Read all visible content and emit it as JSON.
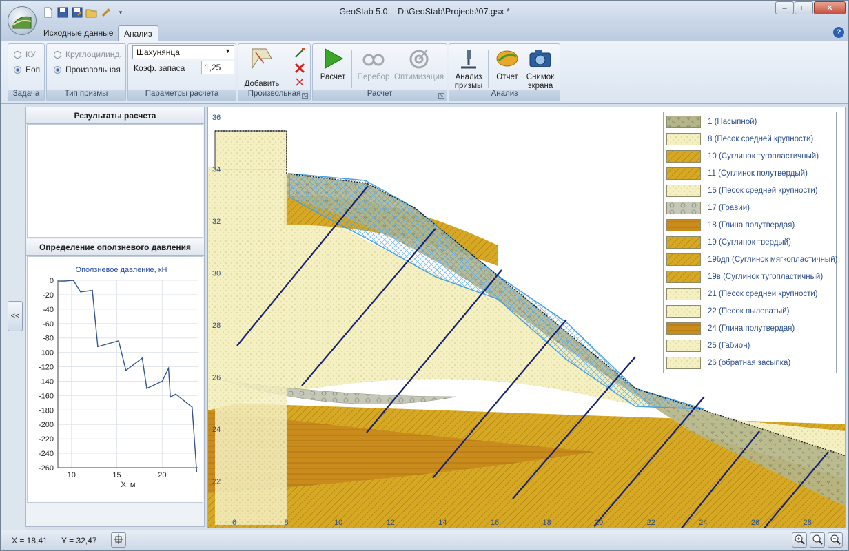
{
  "window": {
    "title": "GeoStab 5.0: - D:\\GeoStab\\Projects\\07.gsx *",
    "controls": {
      "minimize": "–",
      "maximize": "□",
      "close": "✕"
    }
  },
  "quick_access": [
    "new-icon",
    "save-icon",
    "save-as-icon",
    "open-icon",
    "tools-icon"
  ],
  "tabs": [
    {
      "label": "Исходные данные",
      "active": false
    },
    {
      "label": "Анализ",
      "active": true
    }
  ],
  "help_label": "?",
  "ribbon": {
    "task": {
      "caption": "Задача",
      "options": [
        {
          "label": "КУ",
          "selected": false
        },
        {
          "label": "Еоп",
          "selected": true
        }
      ]
    },
    "prism_type": {
      "caption": "Тип призмы",
      "options": [
        {
          "label": "Круглоцилинд.",
          "selected": false
        },
        {
          "label": "Произвольная",
          "selected": true
        }
      ]
    },
    "params": {
      "caption": "Параметры расчета",
      "method": "Шахунянца",
      "factor_label": "Коэф. запаса",
      "factor_value": "1,25"
    },
    "arbitrary": {
      "caption": "Произвольная",
      "add_label": "Добавить"
    },
    "calc": {
      "caption": "Расчет",
      "run_label": "Расчет",
      "search_label": "Перебор",
      "optimize_label": "Оптимизация"
    },
    "analysis": {
      "caption": "Анализ",
      "prism_label_1": "Анализ",
      "prism_label_2": "призмы",
      "report_label": "Отчет",
      "screenshot_label_1": "Снимок",
      "screenshot_label_2": "экрана"
    }
  },
  "left_panel": {
    "collapse_label": "<<",
    "results_title": "Результаты расчета",
    "landslide_title": "Определение оползневого давления"
  },
  "chart_data": {
    "type": "line",
    "title": "Оползневое давление, кН",
    "xlabel": "X, м",
    "ylabel": "",
    "xlim": [
      8.5,
      24
    ],
    "ylim": [
      -260,
      0
    ],
    "xticks": [
      "10",
      "15",
      "20"
    ],
    "yticks": [
      "0",
      "-20",
      "-40",
      "-60",
      "-80",
      "-100",
      "-120",
      "-140",
      "-160",
      "-180",
      "-200",
      "-220",
      "-240",
      "-260"
    ],
    "grid": true,
    "color": "#34568c",
    "x": [
      8.6,
      9.2,
      10.2,
      11.0,
      12.3,
      12.9,
      15.2,
      16.0,
      17.8,
      18.3,
      20.0,
      20.7,
      20.9,
      21.5,
      23.3,
      23.8
    ],
    "y": [
      -1,
      -1,
      0,
      -16,
      -14,
      -92,
      -84,
      -125,
      -108,
      -150,
      -140,
      -122,
      -162,
      -158,
      -176,
      -265
    ]
  },
  "canvas": {
    "x_ticks": [
      "6",
      "8",
      "10",
      "12",
      "14",
      "16",
      "18",
      "20",
      "22",
      "24",
      "26",
      "28"
    ],
    "y_ticks": [
      "36",
      "34",
      "32",
      "30",
      "28",
      "26",
      "24",
      "22"
    ]
  },
  "legend": [
    {
      "label": "1 (Насыпной)",
      "pattern": "fill-nasypnoy"
    },
    {
      "label": "8 (Песок средней крупности)",
      "pattern": "fill-sand"
    },
    {
      "label": "10 (Суглинок тугопластичный)",
      "pattern": "fill-loam"
    },
    {
      "label": "11 (Суглинок полутвердый)",
      "pattern": "fill-loam"
    },
    {
      "label": "15 (Песок средней крупности)",
      "pattern": "fill-sand"
    },
    {
      "label": "17 (Гравий)",
      "pattern": "fill-gravel"
    },
    {
      "label": "18 (Глина полутвердая)",
      "pattern": "fill-clay"
    },
    {
      "label": "19 (Суглинок твердый)",
      "pattern": "fill-loam"
    },
    {
      "label": "19бдп (Суглинок мягкопластичный)",
      "pattern": "fill-loam"
    },
    {
      "label": "19в (Суглинок тугопластичный)",
      "pattern": "fill-loam"
    },
    {
      "label": "21 (Песок средней крупности)",
      "pattern": "fill-sand"
    },
    {
      "label": "22 (Песок пылеватый)",
      "pattern": "fill-sand"
    },
    {
      "label": "24 (Глина полутвердая)",
      "pattern": "fill-clay"
    },
    {
      "label": "25 (Габион)",
      "pattern": "fill-sand"
    },
    {
      "label": "26 (обратная засыпка)",
      "pattern": "fill-sand"
    }
  ],
  "status": {
    "x": "X = 18,41",
    "y": "Y = 32,47"
  }
}
